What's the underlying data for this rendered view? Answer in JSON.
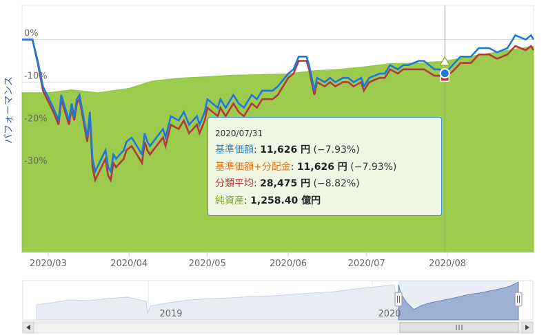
{
  "chart_data": {
    "type": "line",
    "ylabel": "パフォーマンス",
    "y_tick_labels": [
      "0%",
      "-10%",
      "-20%",
      "-30%"
    ],
    "x_tick_labels": [
      "2020/03",
      "2020/04",
      "2020/05",
      "2020/06",
      "2020/07",
      "2020/08"
    ],
    "yaxis_percent_range": [
      -50,
      8
    ],
    "navigator_labels": [
      "2019",
      "2020"
    ],
    "series": [
      {
        "name": "基準価額",
        "color": "#1e78dc",
        "x": [
          "2020-02-20",
          "2020-02-24",
          "2020-02-26",
          "2020-02-28",
          "2020-03-03",
          "2020-03-05",
          "2020-03-06",
          "2020-03-09",
          "2020-03-10",
          "2020-03-11",
          "2020-03-12",
          "2020-03-13",
          "2020-03-16",
          "2020-03-17",
          "2020-03-18",
          "2020-03-19",
          "2020-03-23",
          "2020-03-24",
          "2020-03-25",
          "2020-03-26",
          "2020-03-27",
          "2020-03-30",
          "2020-03-31",
          "2020-04-02",
          "2020-04-06",
          "2020-04-07",
          "2020-04-08",
          "2020-04-09",
          "2020-04-14",
          "2020-04-15",
          "2020-04-17",
          "2020-04-20",
          "2020-04-21",
          "2020-04-22",
          "2020-04-24",
          "2020-04-27",
          "2020-04-28",
          "2020-04-30",
          "2020-05-01",
          "2020-05-05",
          "2020-05-06",
          "2020-05-08",
          "2020-05-11",
          "2020-05-13",
          "2020-05-15",
          "2020-05-18",
          "2020-05-20",
          "2020-05-22",
          "2020-05-26",
          "2020-05-28",
          "2020-06-01",
          "2020-06-03",
          "2020-06-05",
          "2020-06-08",
          "2020-06-09",
          "2020-06-11",
          "2020-06-12",
          "2020-06-15",
          "2020-06-17",
          "2020-06-19",
          "2020-06-22",
          "2020-06-24",
          "2020-06-26",
          "2020-06-29",
          "2020-06-30",
          "2020-07-02",
          "2020-07-06",
          "2020-07-08",
          "2020-07-10",
          "2020-07-13",
          "2020-07-15",
          "2020-07-17",
          "2020-07-21",
          "2020-07-23",
          "2020-07-27",
          "2020-07-29",
          "2020-07-31",
          "2020-08-03",
          "2020-08-06",
          "2020-08-10",
          "2020-08-13",
          "2020-08-17",
          "2020-08-20",
          "2020-08-24",
          "2020-08-27",
          "2020-08-31",
          "2020-09-02",
          "2020-09-03"
        ],
        "y": [
          0,
          0,
          -5,
          -11,
          -16,
          -19,
          -13,
          -19,
          -15,
          -18,
          -14,
          -13,
          -23,
          -17,
          -28,
          -31,
          -26,
          -30,
          -31,
          -27,
          -28,
          -26,
          -24,
          -23,
          -27,
          -22,
          -24,
          -25,
          -21,
          -23,
          -18,
          -19,
          -18,
          -17,
          -20,
          -18,
          -20,
          -17,
          -14,
          -16,
          -14,
          -16,
          -13,
          -15,
          -16,
          -13,
          -14,
          -12,
          -12,
          -11,
          -8,
          -7,
          -4,
          -4,
          -6,
          -12,
          -9,
          -10,
          -9,
          -10,
          -9,
          -9,
          -10,
          -9,
          -11,
          -9,
          -8,
          -8,
          -6,
          -7,
          -6,
          -6,
          -5,
          -5,
          -7,
          -7,
          -7.93,
          -6,
          -4,
          -4,
          -2,
          -2,
          -3,
          -2,
          1,
          0,
          1,
          0
        ]
      },
      {
        "name": "分類平均",
        "color": "#b03a3a",
        "x": [
          "2020-02-20",
          "2020-02-24",
          "2020-02-26",
          "2020-02-28",
          "2020-03-03",
          "2020-03-05",
          "2020-03-06",
          "2020-03-09",
          "2020-03-10",
          "2020-03-11",
          "2020-03-12",
          "2020-03-13",
          "2020-03-16",
          "2020-03-17",
          "2020-03-18",
          "2020-03-19",
          "2020-03-23",
          "2020-03-24",
          "2020-03-25",
          "2020-03-26",
          "2020-03-27",
          "2020-03-30",
          "2020-03-31",
          "2020-04-02",
          "2020-04-06",
          "2020-04-07",
          "2020-04-08",
          "2020-04-09",
          "2020-04-14",
          "2020-04-15",
          "2020-04-17",
          "2020-04-20",
          "2020-04-21",
          "2020-04-22",
          "2020-04-24",
          "2020-04-27",
          "2020-04-28",
          "2020-04-30",
          "2020-05-01",
          "2020-05-05",
          "2020-05-06",
          "2020-05-08",
          "2020-05-11",
          "2020-05-13",
          "2020-05-15",
          "2020-05-18",
          "2020-05-20",
          "2020-05-22",
          "2020-05-26",
          "2020-05-28",
          "2020-06-01",
          "2020-06-03",
          "2020-06-05",
          "2020-06-08",
          "2020-06-09",
          "2020-06-11",
          "2020-06-12",
          "2020-06-15",
          "2020-06-17",
          "2020-06-19",
          "2020-06-22",
          "2020-06-24",
          "2020-06-26",
          "2020-06-29",
          "2020-06-30",
          "2020-07-02",
          "2020-07-06",
          "2020-07-08",
          "2020-07-10",
          "2020-07-13",
          "2020-07-15",
          "2020-07-17",
          "2020-07-21",
          "2020-07-23",
          "2020-07-27",
          "2020-07-29",
          "2020-07-31",
          "2020-08-03",
          "2020-08-06",
          "2020-08-10",
          "2020-08-13",
          "2020-08-17",
          "2020-08-20",
          "2020-08-24",
          "2020-08-27",
          "2020-08-31",
          "2020-09-02",
          "2020-09-03"
        ],
        "y": [
          0,
          0,
          -5.5,
          -12,
          -17,
          -20,
          -14,
          -20,
          -16,
          -19,
          -15,
          -14,
          -24,
          -18,
          -30,
          -33,
          -28,
          -32,
          -33,
          -29,
          -30,
          -28,
          -26,
          -25,
          -29,
          -24,
          -26,
          -27,
          -23,
          -25,
          -20,
          -21,
          -20,
          -19,
          -22,
          -20,
          -22,
          -19,
          -16,
          -18,
          -16,
          -18,
          -15,
          -17,
          -18,
          -15,
          -16,
          -14,
          -14,
          -13,
          -9,
          -8,
          -5,
          -5,
          -7,
          -13,
          -10,
          -11,
          -10,
          -11,
          -10,
          -10,
          -11,
          -10,
          -12,
          -10,
          -9,
          -9,
          -7,
          -8,
          -7,
          -7,
          -7,
          -7,
          -8.5,
          -8.5,
          -8.82,
          -7.5,
          -5.5,
          -5.5,
          -3.5,
          -3.5,
          -4.5,
          -3.5,
          -1.5,
          -2.5,
          -1.5,
          -2.5
        ]
      },
      {
        "name": "純資産",
        "color": "#8cc63f",
        "type": "area",
        "unit": "億円",
        "x": [
          "2020-02-20",
          "2020-03-01",
          "2020-03-10",
          "2020-03-20",
          "2020-04-01",
          "2020-04-10",
          "2020-04-20",
          "2020-05-01",
          "2020-05-10",
          "2020-05-20",
          "2020-06-01",
          "2020-06-10",
          "2020-06-20",
          "2020-07-01",
          "2020-07-10",
          "2020-07-20",
          "2020-07-31",
          "2020-08-10",
          "2020-08-20",
          "2020-09-03"
        ],
        "y": [
          1150,
          1150,
          1160,
          1150,
          1165,
          1190,
          1200,
          1205,
          1210,
          1212,
          1215,
          1225,
          1230,
          1240,
          1250,
          1252,
          1258.4,
          1275,
          1290,
          1310
        ]
      }
    ],
    "tooltip": {
      "date": "2020/07/31",
      "rows": [
        {
          "label": "基準価額",
          "sep": ": ",
          "value": "11,626 円",
          "change": " (−7.93%)",
          "color": "#2a84d2"
        },
        {
          "label": "基準価額+分配金",
          "sep": ": ",
          "value": "11,626 円",
          "change": " (−7.93%)",
          "color": "#e0761e"
        },
        {
          "label": "分類平均",
          "sep": ": ",
          "value": "28,475 円",
          "change": " (−8.82%)",
          "color": "#b03a3a"
        },
        {
          "label": "純資産",
          "sep": ": ",
          "value": "1,258.40 億円",
          "change": "",
          "color": "#7dab2a"
        }
      ]
    }
  },
  "colors": {
    "main_line": "#1e78dc",
    "avg_line": "#b03a3a",
    "area_fill": "#9dcb4e",
    "area_stroke": "#8cc63f",
    "crosshair": "#a0a0a0",
    "navigator_fill": "#e8edf5",
    "navigator_selected": "#a8b8d8"
  }
}
